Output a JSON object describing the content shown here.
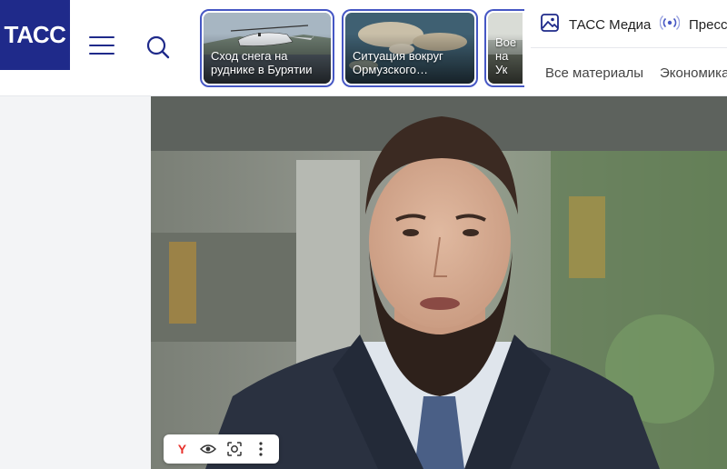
{
  "header": {
    "logo_text": "ТАСС",
    "brand_color": "#1f2a8a",
    "menu_icon": "hamburger-icon",
    "search_icon": "search-icon"
  },
  "stories": [
    {
      "title": "Сход снега на\nруднике в Бурятии"
    },
    {
      "title": "Ситуация вокруг\nОрмузского…"
    },
    {
      "title": "Воен\nна Ук"
    }
  ],
  "top_links": {
    "media_label": "ТАСС Медиа",
    "press_label": "Пресс"
  },
  "nav": {
    "items": [
      "Все материалы",
      "Экономика"
    ]
  },
  "photo_toolbar": {
    "yandex_label": "Y",
    "icons": [
      "yandex-icon",
      "eye-icon",
      "lens-icon",
      "more-icon"
    ]
  }
}
